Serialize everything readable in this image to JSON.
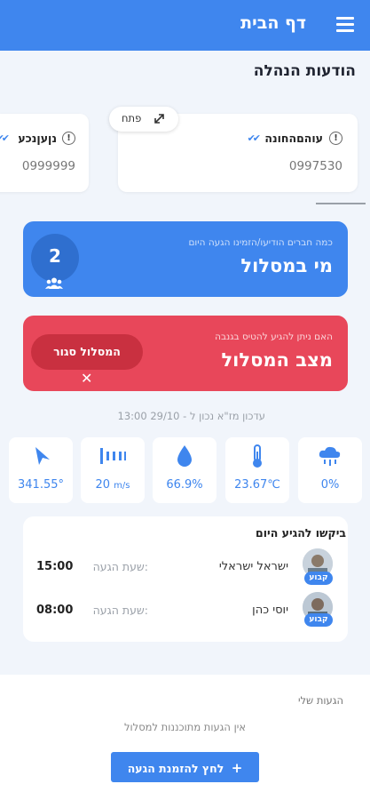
{
  "header": {
    "title": "דף הבית",
    "menu_icon": "menu-icon"
  },
  "section_title": "הודעות הנהלה",
  "messages": [
    {
      "name": "עוהםהחונה",
      "number": "0997530"
    },
    {
      "name": "נןעןנכע",
      "number": "0999999"
    }
  ],
  "open_button": {
    "label": "פתח",
    "icon": "expand-icon"
  },
  "who_card": {
    "subtitle": "כמה חברים הודיעו/הזמינו הגעה היום",
    "title": "מי במסלול",
    "count": "2",
    "icon": "people-icon"
  },
  "status_card": {
    "subtitle": "האם ניתן להגיע להטיס בגנבה",
    "title": "מצב המסלול",
    "pill_label": "המסלול סגור",
    "close_icon": "close-icon"
  },
  "update_text": "עדכון מז\"א נכון ל - 29/10 13:00",
  "weather": [
    {
      "icon": "rain-cloud-icon",
      "value": "0%"
    },
    {
      "icon": "thermometer-icon",
      "value": "23.67℃"
    },
    {
      "icon": "water-drop-icon",
      "value": "66.9%"
    },
    {
      "icon": "wind-icon",
      "value": "20",
      "unit": "m/s"
    },
    {
      "icon": "direction-arrow-icon",
      "value": "341.55°"
    }
  ],
  "today": {
    "title": "ביקשו להגיע היום",
    "arrival_label": "שעת הגעה:",
    "people": [
      {
        "name": "ישראל ישראלי",
        "time": "15:00",
        "tag": "קבוע"
      },
      {
        "name": "יוסי כהן",
        "time": "08:00",
        "tag": "קבוע"
      }
    ]
  },
  "my_arrivals": {
    "title": "הגעות שלי",
    "empty_text": "אין הגעות מתוכננות למסלול",
    "invite_button": "לחץ להזמנת הגעה"
  },
  "colors": {
    "primary": "#3f86ee",
    "danger": "#e8475a",
    "background": "#f1f5fb"
  }
}
